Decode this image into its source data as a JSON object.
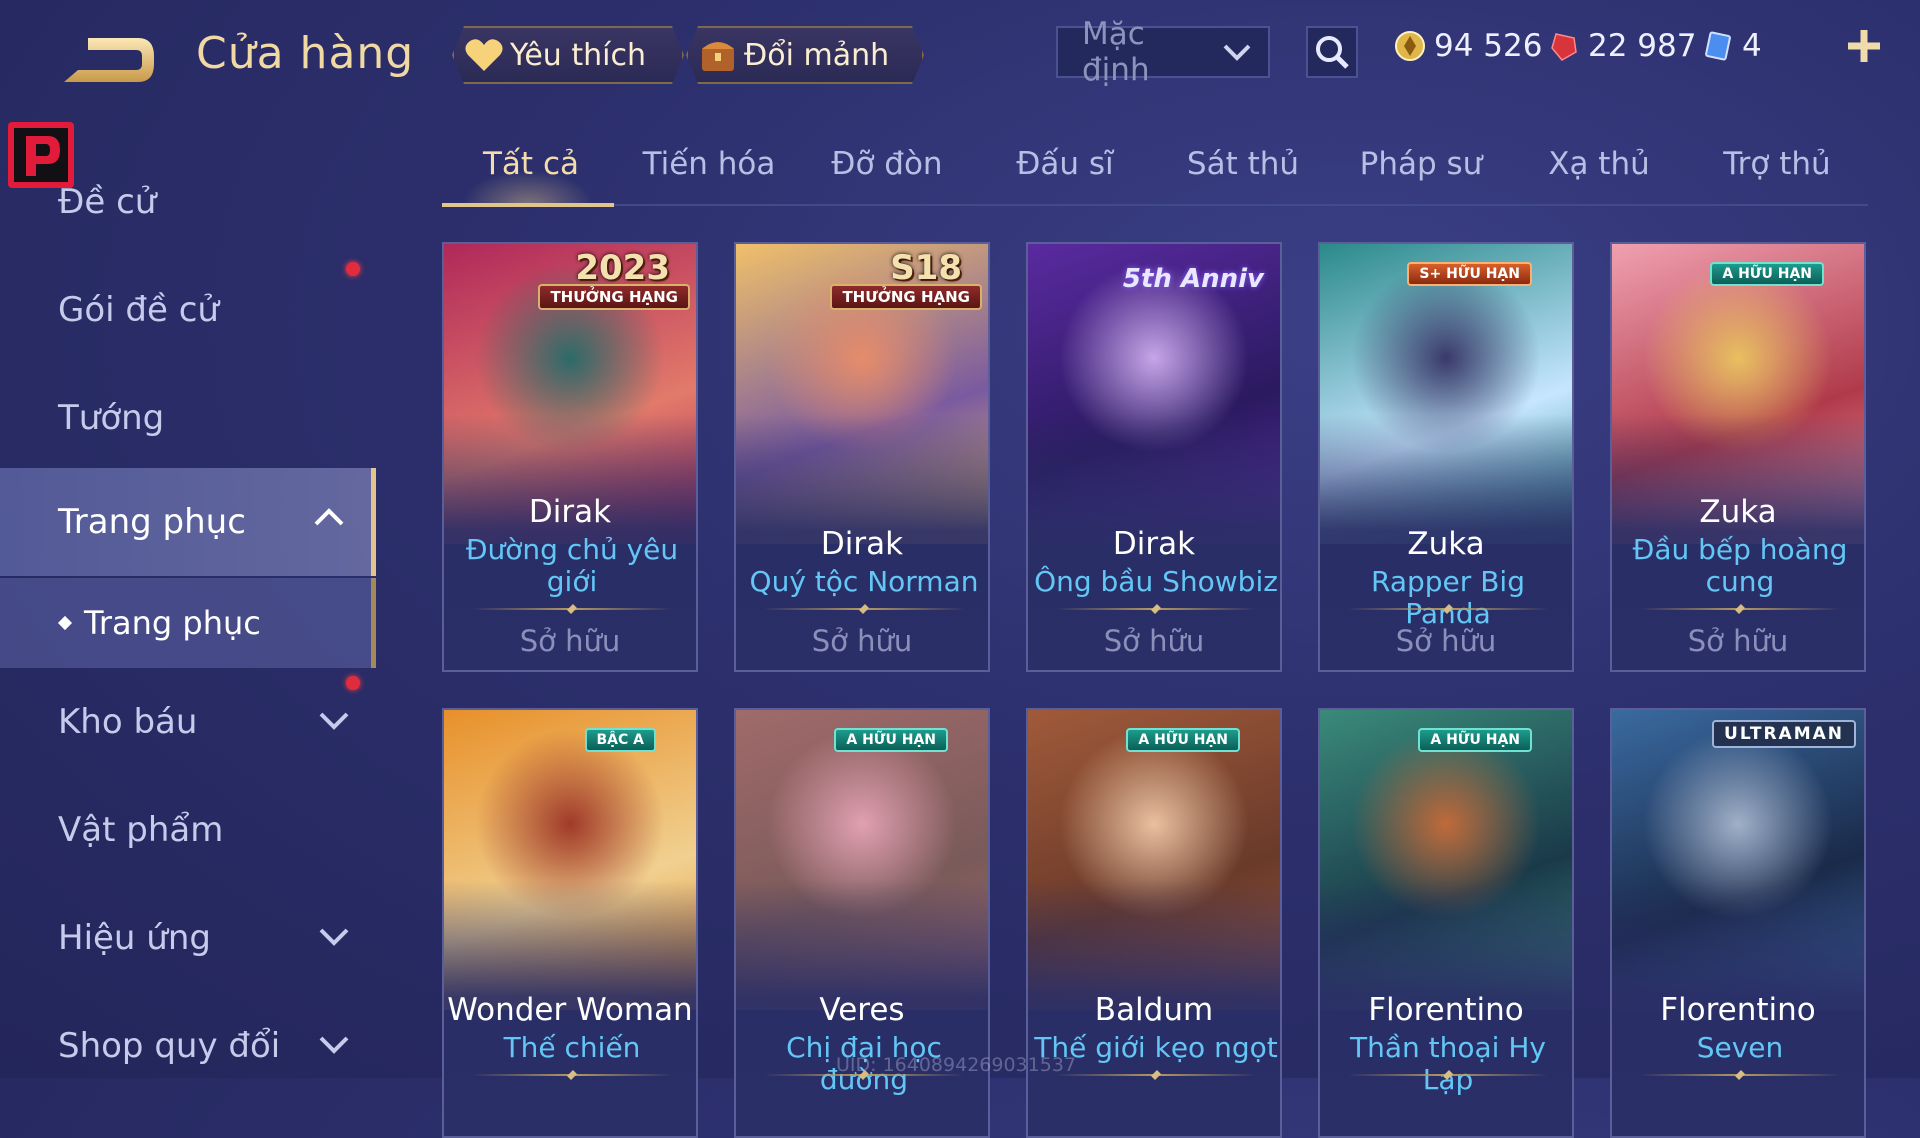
{
  "header": {
    "title": "Cửa hàng",
    "favorite_label": "Yêu thích",
    "exchange_label": "Đổi mảnh",
    "sort_value": "Mặc định",
    "currencies": {
      "gold": "94 526",
      "voucher": "22 987",
      "token": "4"
    },
    "colors": {
      "accent_gold": "#e2c58b",
      "skin_name": "#63c6f5",
      "background": "#2c2f6c"
    }
  },
  "sidebar": {
    "items": [
      {
        "label": "Đề cử"
      },
      {
        "label": "Gói đề cử"
      },
      {
        "label": "Tướng"
      },
      {
        "label": "Trang phục"
      },
      {
        "label": "Trang phục"
      },
      {
        "label": "Kho báu"
      },
      {
        "label": "Vật phẩm"
      },
      {
        "label": "Hiệu ứng"
      },
      {
        "label": "Shop quy đổi"
      }
    ]
  },
  "tabs": [
    "Tất cả",
    "Tiến hóa",
    "Đỡ đòn",
    "Đấu sĩ",
    "Sát thủ",
    "Pháp sư",
    "Xạ thủ",
    "Trợ thủ"
  ],
  "cards": [
    {
      "hero": "Dirak",
      "skin_line1": "Đường chủ yêu",
      "skin_line2": "giới",
      "status": "Sở hữu",
      "badge_top": "2023",
      "badge": "THƯỞNG HẠNG",
      "art_colors": [
        "#b0285a",
        "#2c6b68",
        "#e27a6a"
      ]
    },
    {
      "hero": "Dirak",
      "skin_line1": "Quý tộc Norman",
      "skin_line2": "",
      "status": "Sở hữu",
      "badge_top": "S18",
      "badge": "THƯỞNG HẠNG",
      "art_colors": [
        "#f0c06a",
        "#e68c6a",
        "#7a5aa0"
      ]
    },
    {
      "hero": "Dirak",
      "skin_line1": "Ông bầu Showbiz",
      "skin_line2": "",
      "status": "Sở hữu",
      "badge_top": "",
      "badge": "5th Anniv",
      "art_colors": [
        "#5a2aa0",
        "#c6a6e8",
        "#2a1a60"
      ]
    },
    {
      "hero": "Zuka",
      "skin_line1": "Rapper Big Panda",
      "skin_line2": "",
      "status": "Sở hữu",
      "badge_top": "",
      "badge": "S+ HỮU HẠN",
      "art_colors": [
        "#2a8a8a",
        "#3a3a6a",
        "#c6e6ff"
      ]
    },
    {
      "hero": "Zuka",
      "skin_line1": "Đầu bếp hoàng",
      "skin_line2": "cung",
      "status": "Sở hữu",
      "badge_top": "",
      "badge": "A HỮU HẠN",
      "art_colors": [
        "#f0a0b0",
        "#e8c060",
        "#b03a4a"
      ]
    },
    {
      "hero": "Wonder Woman",
      "skin_line1": "Thế chiến",
      "skin_line2": "",
      "status": "",
      "badge_top": "",
      "badge": "BẬC A",
      "art_colors": [
        "#e8902a",
        "#a03a2a",
        "#f0d090"
      ]
    },
    {
      "hero": "Veres",
      "skin_line1": "Chị đại học đường",
      "skin_line2": "",
      "status": "",
      "badge_top": "",
      "badge": "A HỮU HẠN",
      "art_colors": [
        "#a06a6a",
        "#e0a0b0",
        "#7a5a5a"
      ]
    },
    {
      "hero": "Baldum",
      "skin_line1": "Thế giới kẹo ngọt",
      "skin_line2": "",
      "status": "",
      "badge_top": "",
      "badge": "A HỮU HẠN",
      "art_colors": [
        "#a05a3a",
        "#e8c0a0",
        "#6a3a2a"
      ]
    },
    {
      "hero": "Florentino",
      "skin_line1": "Thần thoại Hy Lạp",
      "skin_line2": "",
      "status": "",
      "badge_top": "",
      "badge": "A HỮU HẠN",
      "art_colors": [
        "#3a8a7a",
        "#c06a3a",
        "#1a3a4a"
      ]
    },
    {
      "hero": "Florentino",
      "skin_line1": "Seven",
      "skin_line2": "",
      "status": "",
      "badge_top": "",
      "badge": "ULTRAMAN",
      "art_colors": [
        "#3a6aa0",
        "#a0b0c8",
        "#1a2a4a"
      ]
    }
  ],
  "footer": {
    "uid": "UID: 1640894269031537"
  }
}
